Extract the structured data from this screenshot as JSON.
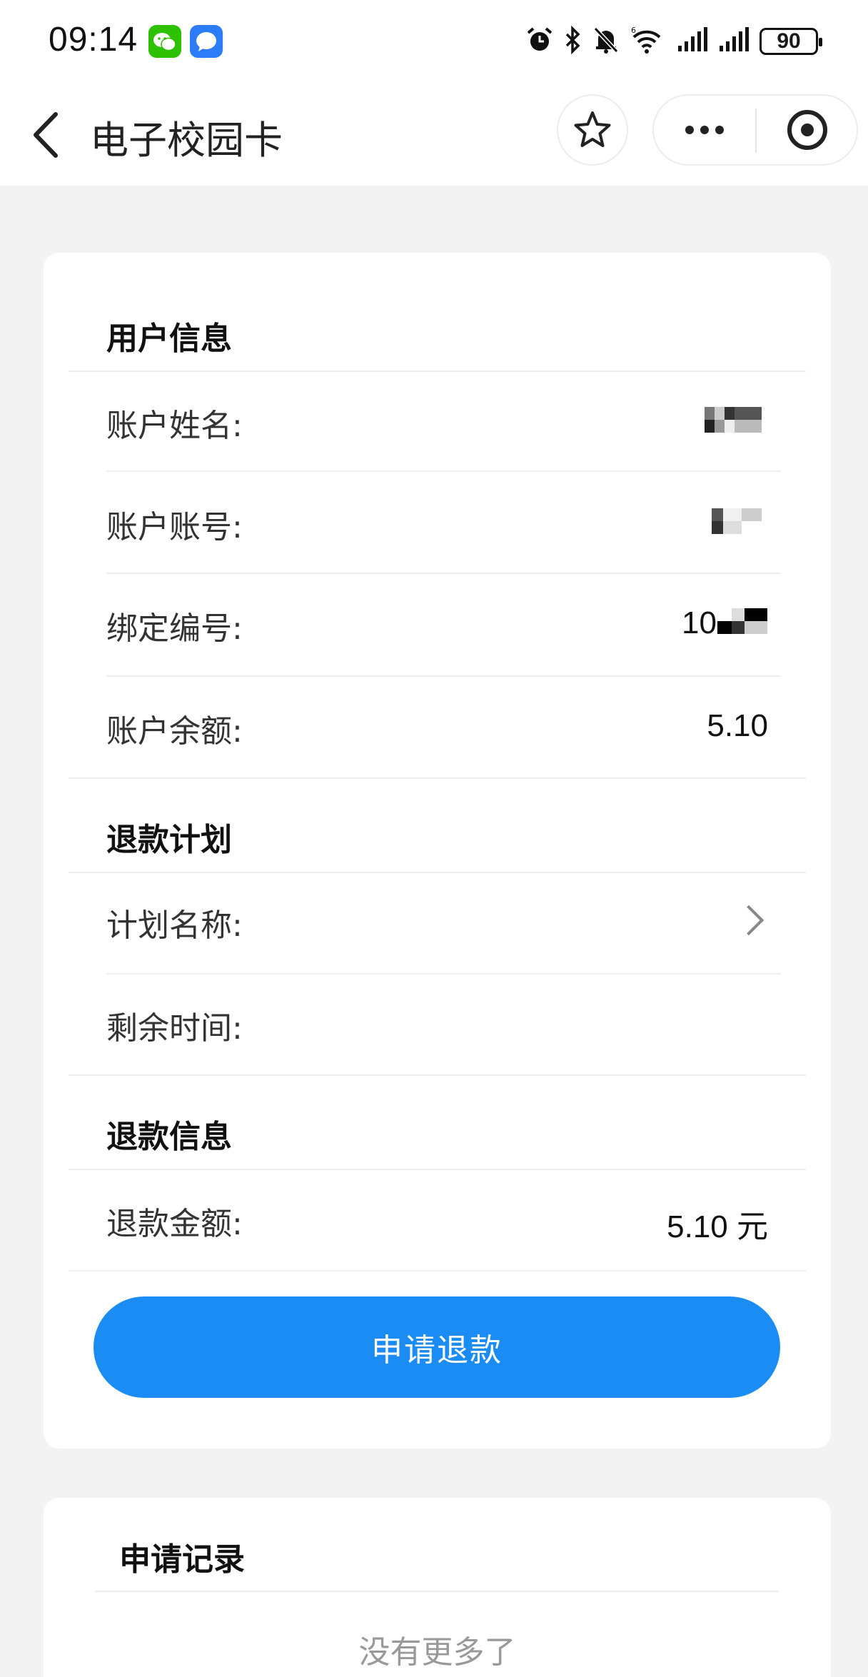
{
  "status_bar": {
    "time": "09:14",
    "battery": "90",
    "icons": [
      "wechat-icon",
      "message-icon",
      "alarm-icon",
      "bluetooth-icon",
      "mute-icon",
      "wifi-icon",
      "signal-icon",
      "signal-icon"
    ]
  },
  "nav": {
    "title": "电子校园卡",
    "back_icon": "back-arrow-icon",
    "favorite_icon": "star-icon",
    "more_icon": "more-dots-icon",
    "close_icon": "target-icon"
  },
  "user_info": {
    "title": "用户信息",
    "rows": [
      {
        "label": "账户姓名:",
        "value": ""
      },
      {
        "label": "账户账号:",
        "value": ""
      },
      {
        "label": "绑定编号:",
        "value": "10"
      },
      {
        "label": "账户余额:",
        "value": "5.10"
      }
    ]
  },
  "refund_plan": {
    "title": "退款计划",
    "rows": [
      {
        "label": "计划名称:",
        "value": ""
      },
      {
        "label": "剩余时间:",
        "value": ""
      }
    ]
  },
  "refund_info": {
    "title": "退款信息",
    "rows": [
      {
        "label": "退款金额:",
        "value": "5.10 元"
      }
    ]
  },
  "apply_button": {
    "label": "申请退款"
  },
  "records": {
    "title": "申请记录",
    "empty_text": "没有更多了"
  },
  "colors": {
    "accent": "#1a8cf3",
    "background": "#f3f3f3",
    "card": "#ffffff"
  }
}
